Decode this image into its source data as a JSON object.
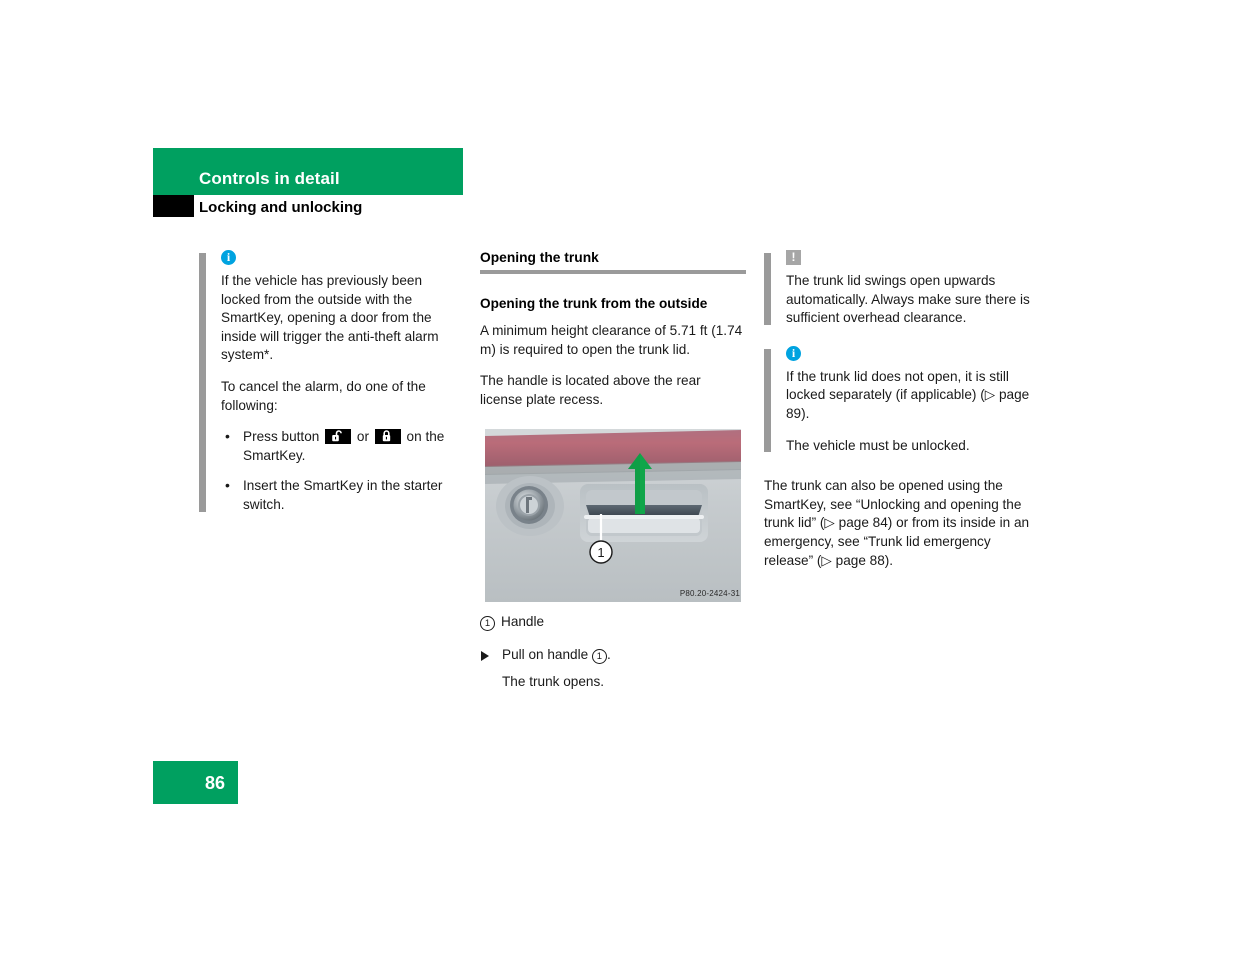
{
  "header": {
    "chapter_title": "Controls in detail",
    "section_title": "Locking and unlocking",
    "green_hex": "#00A060",
    "black_square": "black-marker"
  },
  "left_column": {
    "note": {
      "icon": "info-icon",
      "icon_color": "#00A3E0",
      "paragraph_1": "If the vehicle has previously been locked from the outside with the SmartKey, opening a door from the inside will trigger the anti-theft alarm system*.",
      "paragraph_2": "To cancel the alarm, do one of the following:",
      "bullets": [
        {
          "text_before": "Press button",
          "icon_1": "unlock-key-button-icon",
          "text_middle": "or",
          "icon_2": "lock-key-button-icon",
          "text_after": "on the SmartKey."
        },
        {
          "text": "Insert the SmartKey in the starter switch."
        }
      ]
    }
  },
  "middle_column": {
    "heading": "Opening the trunk",
    "subheading": "Opening the trunk from the outside",
    "paragraph_1": "A minimum height clearance of 5.71 ft (1.74 m) is required to open the trunk lid.",
    "paragraph_2": "The handle is located above the rear license plate recess.",
    "figure": {
      "alt": "trunk-handle-photo",
      "code": "P80.20-2424-31",
      "callout": "1",
      "arrow": "up-arrow-green",
      "arrow_color": "#11A64A"
    },
    "legend": {
      "number": "1",
      "label": "Handle"
    },
    "step": {
      "marker": "triangle-bullet",
      "text_before": "Pull on handle",
      "callout": "1",
      "text_after": "."
    },
    "step_result": "The trunk opens."
  },
  "right_column": {
    "warning_note": {
      "icon": "warning-icon",
      "icon_color": "#a6a6a6",
      "text": "The trunk lid swings open upwards automatically. Always make sure there is sufficient overhead clearance."
    },
    "info_note": {
      "icon": "info-icon",
      "icon_color": "#00A3E0",
      "paragraph_1": "If the trunk lid does not open, it is still locked separately (if applicable) (▷ page 89).",
      "paragraph_2": "The vehicle must be unlocked."
    },
    "paragraph": "The trunk can also be opened using the SmartKey, see “Unlocking and opening the trunk lid” (▷ page 84) or from its inside in an emergency, see “Trunk lid emergency release” (▷ page 88)."
  },
  "footer": {
    "page_number": "86"
  }
}
